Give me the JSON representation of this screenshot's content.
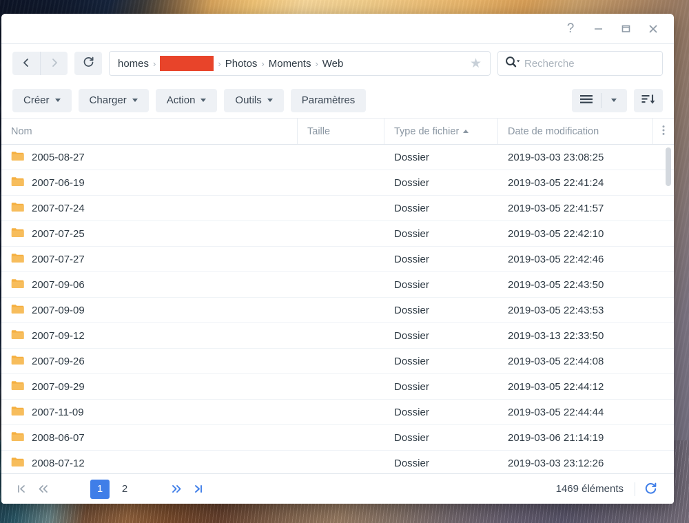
{
  "window": {
    "controls": {
      "help_label": "?",
      "minimize_label": "minimize",
      "maximize_label": "maximize",
      "close_label": "close"
    }
  },
  "navbar": {
    "back_label": "back",
    "forward_label": "forward",
    "refresh_label": "refresh",
    "breadcrumb": [
      "homes",
      "[REDACTED]",
      "Photos",
      "Moments",
      "Web"
    ],
    "breadcrumb_separator": "›",
    "redacted_index": 1,
    "redacted_color": "#e8442a",
    "favorite_label": "★",
    "search": {
      "placeholder": "Recherche",
      "value": "",
      "icon": "search-icon"
    }
  },
  "toolbar": {
    "buttons": [
      {
        "label": "Créer",
        "has_caret": true
      },
      {
        "label": "Charger",
        "has_caret": true
      },
      {
        "label": "Action",
        "has_caret": true
      },
      {
        "label": "Outils",
        "has_caret": true
      },
      {
        "label": "Paramètres",
        "has_caret": false
      }
    ],
    "view_mode_label": "list-view",
    "view_mode_caret_label": "view-options",
    "sort_label": "sort-descending"
  },
  "table": {
    "columns": [
      {
        "key": "name",
        "label": "Nom",
        "sorted": false
      },
      {
        "key": "size",
        "label": "Taille",
        "sorted": false
      },
      {
        "key": "type",
        "label": "Type de fichier",
        "sorted": "asc"
      },
      {
        "key": "date",
        "label": "Date de modification",
        "sorted": false
      }
    ],
    "column_menu_label": "⋮",
    "rows": [
      {
        "name": "2005-08-27",
        "size": "",
        "type": "Dossier",
        "date": "2019-03-03 23:08:25"
      },
      {
        "name": "2007-06-19",
        "size": "",
        "type": "Dossier",
        "date": "2019-03-05 22:41:24"
      },
      {
        "name": "2007-07-24",
        "size": "",
        "type": "Dossier",
        "date": "2019-03-05 22:41:57"
      },
      {
        "name": "2007-07-25",
        "size": "",
        "type": "Dossier",
        "date": "2019-03-05 22:42:10"
      },
      {
        "name": "2007-07-27",
        "size": "",
        "type": "Dossier",
        "date": "2019-03-05 22:42:46"
      },
      {
        "name": "2007-09-06",
        "size": "",
        "type": "Dossier",
        "date": "2019-03-05 22:43:50"
      },
      {
        "name": "2007-09-09",
        "size": "",
        "type": "Dossier",
        "date": "2019-03-05 22:43:53"
      },
      {
        "name": "2007-09-12",
        "size": "",
        "type": "Dossier",
        "date": "2019-03-13 22:33:50"
      },
      {
        "name": "2007-09-26",
        "size": "",
        "type": "Dossier",
        "date": "2019-03-05 22:44:08"
      },
      {
        "name": "2007-09-29",
        "size": "",
        "type": "Dossier",
        "date": "2019-03-05 22:44:12"
      },
      {
        "name": "2007-11-09",
        "size": "",
        "type": "Dossier",
        "date": "2019-03-05 22:44:44"
      },
      {
        "name": "2008-06-07",
        "size": "",
        "type": "Dossier",
        "date": "2019-03-06 21:14:19"
      },
      {
        "name": "2008-07-12",
        "size": "",
        "type": "Dossier",
        "date": "2019-03-03 23:12:26"
      }
    ],
    "row_icon": "folder-icon",
    "folder_icon_color": "#f5b041"
  },
  "footer": {
    "pagination": {
      "first_label": "|<",
      "prev_label": "«",
      "pages": [
        "1",
        "2"
      ],
      "active_page": "1",
      "next_label": "»",
      "last_label": ">|"
    },
    "item_count_label": "1469 éléments",
    "refresh_label": "refresh"
  },
  "theme": {
    "accent": "#3f7ee8",
    "folder": "#f5b041",
    "text": "#2f3b45",
    "muted": "#8b97a3"
  }
}
